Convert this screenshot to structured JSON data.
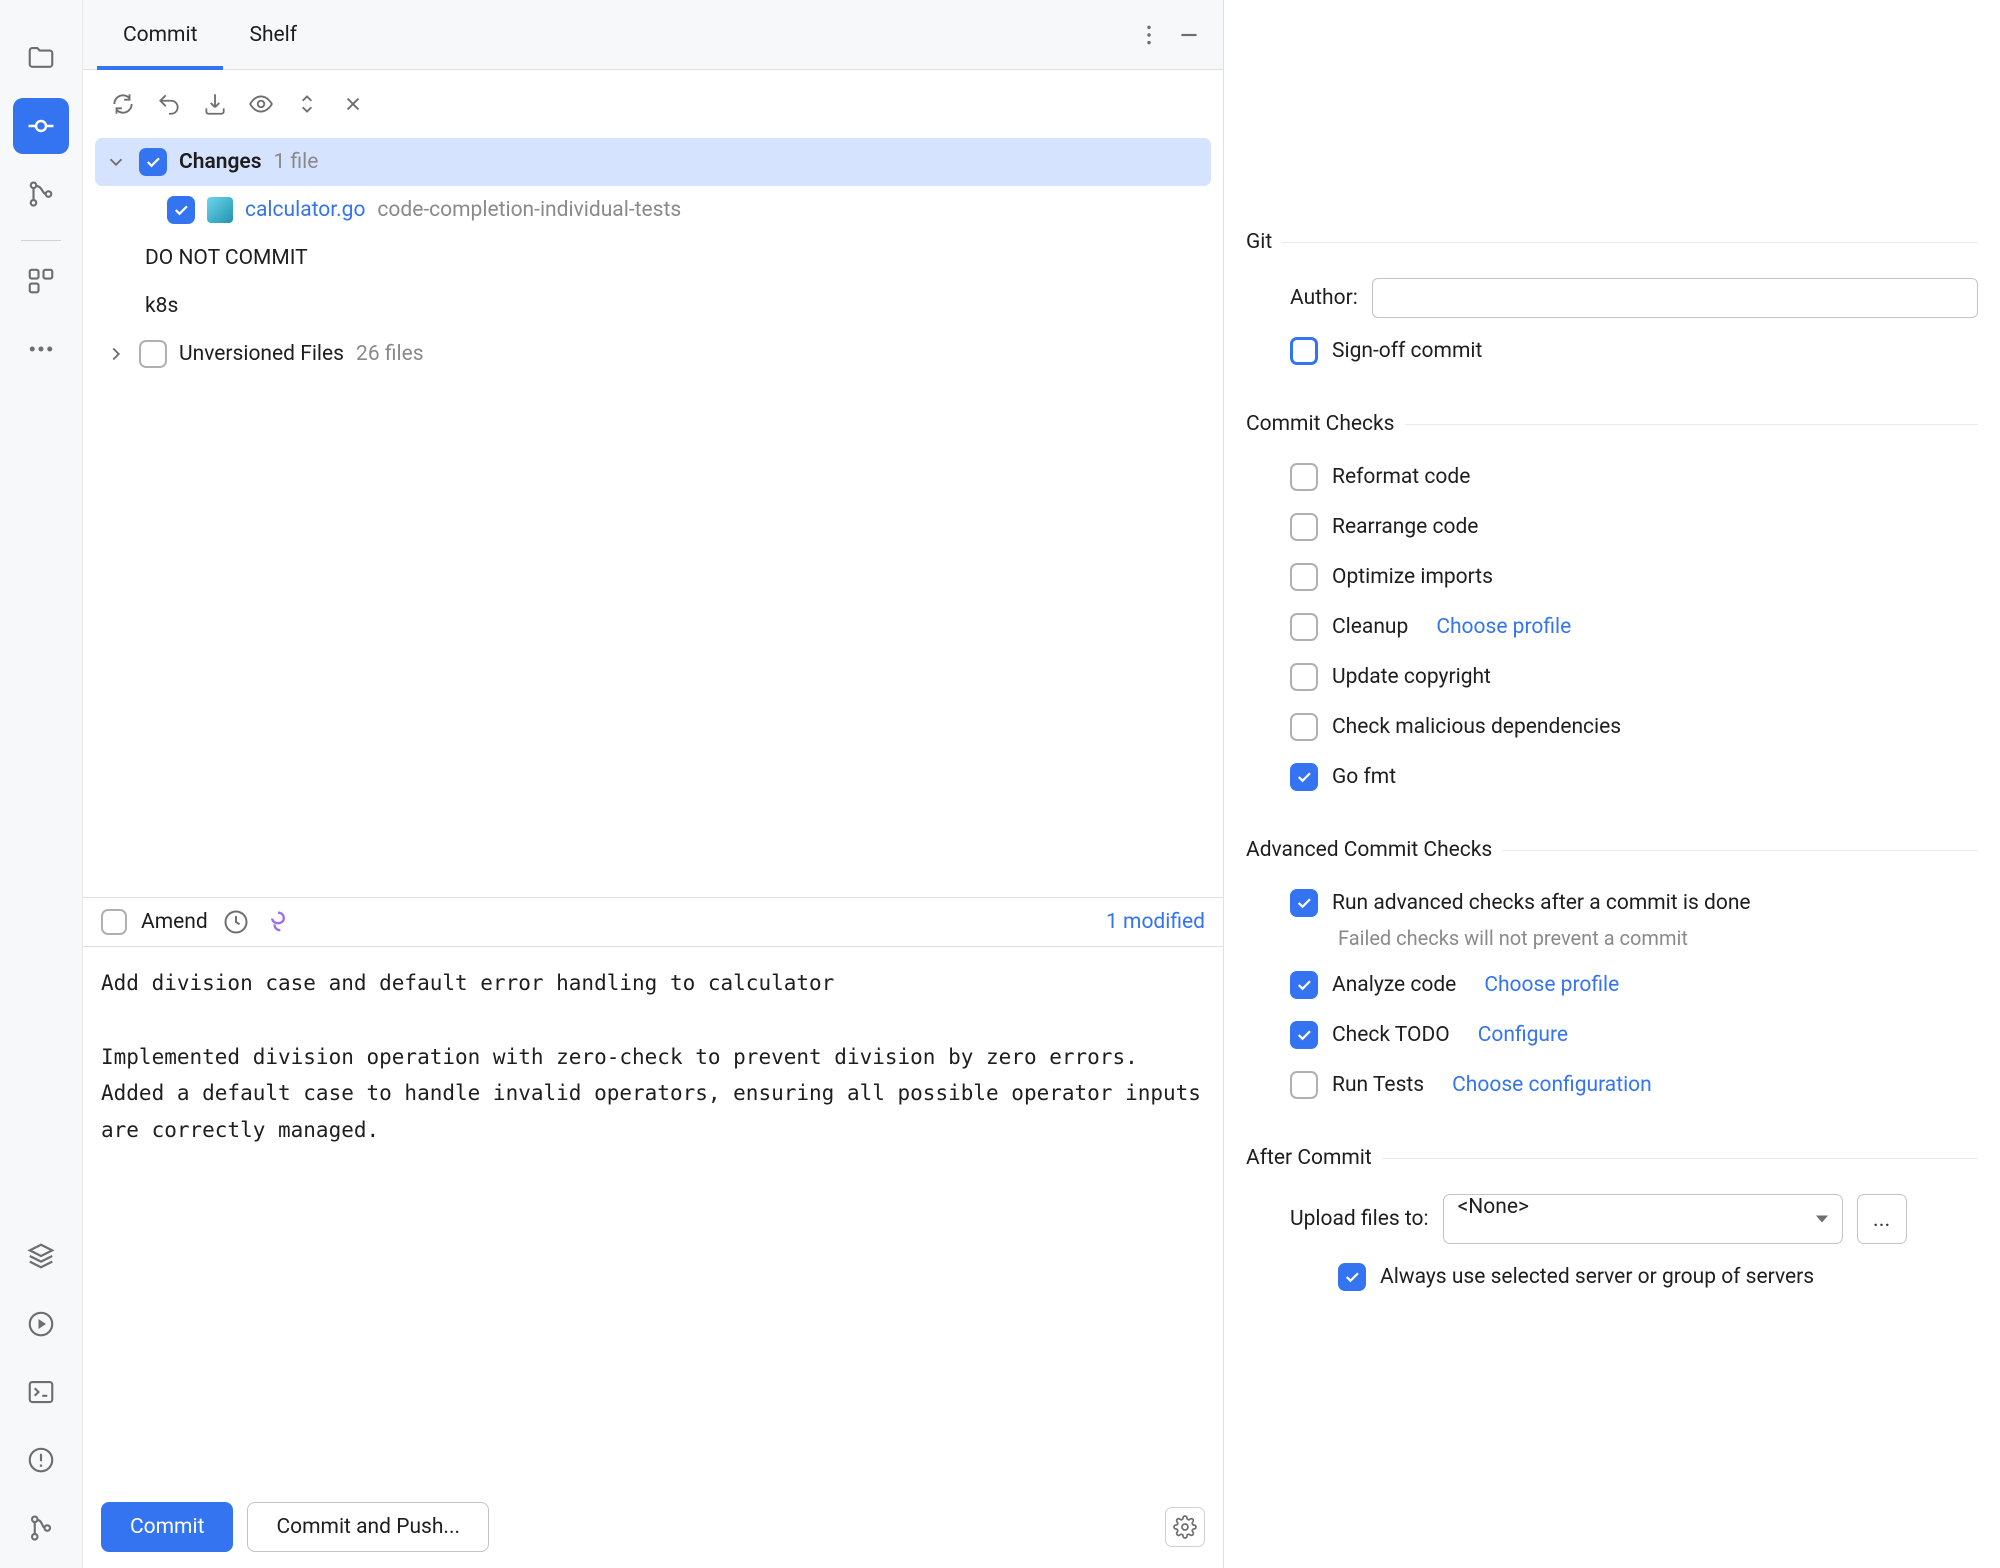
{
  "rail": {
    "icons": [
      "folder-icon",
      "commit-node-icon",
      "branch-graph-icon",
      "structure-icon",
      "more-icon",
      "stacks-icon",
      "play-icon",
      "terminal-icon",
      "problems-icon",
      "git-icon"
    ]
  },
  "tabs": {
    "commit": "Commit",
    "shelf": "Shelf"
  },
  "changes": {
    "label": "Changes",
    "count": "1 file",
    "file": {
      "name": "calculator.go",
      "path": "code-completion-individual-tests"
    },
    "extra1": "DO NOT COMMIT",
    "extra2": "k8s",
    "unversioned": {
      "label": "Unversioned Files",
      "count": "26 files"
    }
  },
  "amend": {
    "label": "Amend",
    "modified": "1 modified"
  },
  "commitMsg": "Add division case and default error handling to calculator\n\nImplemented division operation with zero-check to prevent division by zero errors. Added a default case to handle invalid operators, ensuring all possible operator inputs are correctly managed.",
  "buttons": {
    "commit": "Commit",
    "commitPush": "Commit and Push..."
  },
  "git": {
    "section": "Git",
    "authorLabel": "Author:",
    "authorValue": "",
    "signoff": "Sign-off commit"
  },
  "checks": {
    "section": "Commit Checks",
    "reformat": "Reformat code",
    "rearrange": "Rearrange code",
    "optimize": "Optimize imports",
    "cleanup": "Cleanup",
    "cleanupLink": "Choose profile",
    "copyright": "Update copyright",
    "malicious": "Check malicious dependencies",
    "gofmt": "Go fmt"
  },
  "advanced": {
    "section": "Advanced Commit Checks",
    "runAdvanced": "Run advanced checks after a commit is done",
    "hint": "Failed checks will not prevent a commit",
    "analyze": "Analyze code",
    "analyzeLink": "Choose profile",
    "todo": "Check TODO",
    "todoLink": "Configure",
    "tests": "Run Tests",
    "testsLink": "Choose configuration"
  },
  "after": {
    "section": "After Commit",
    "uploadLabel": "Upload files to:",
    "uploadValue": "<None>",
    "alwaysServer": "Always use selected server or group of servers"
  }
}
